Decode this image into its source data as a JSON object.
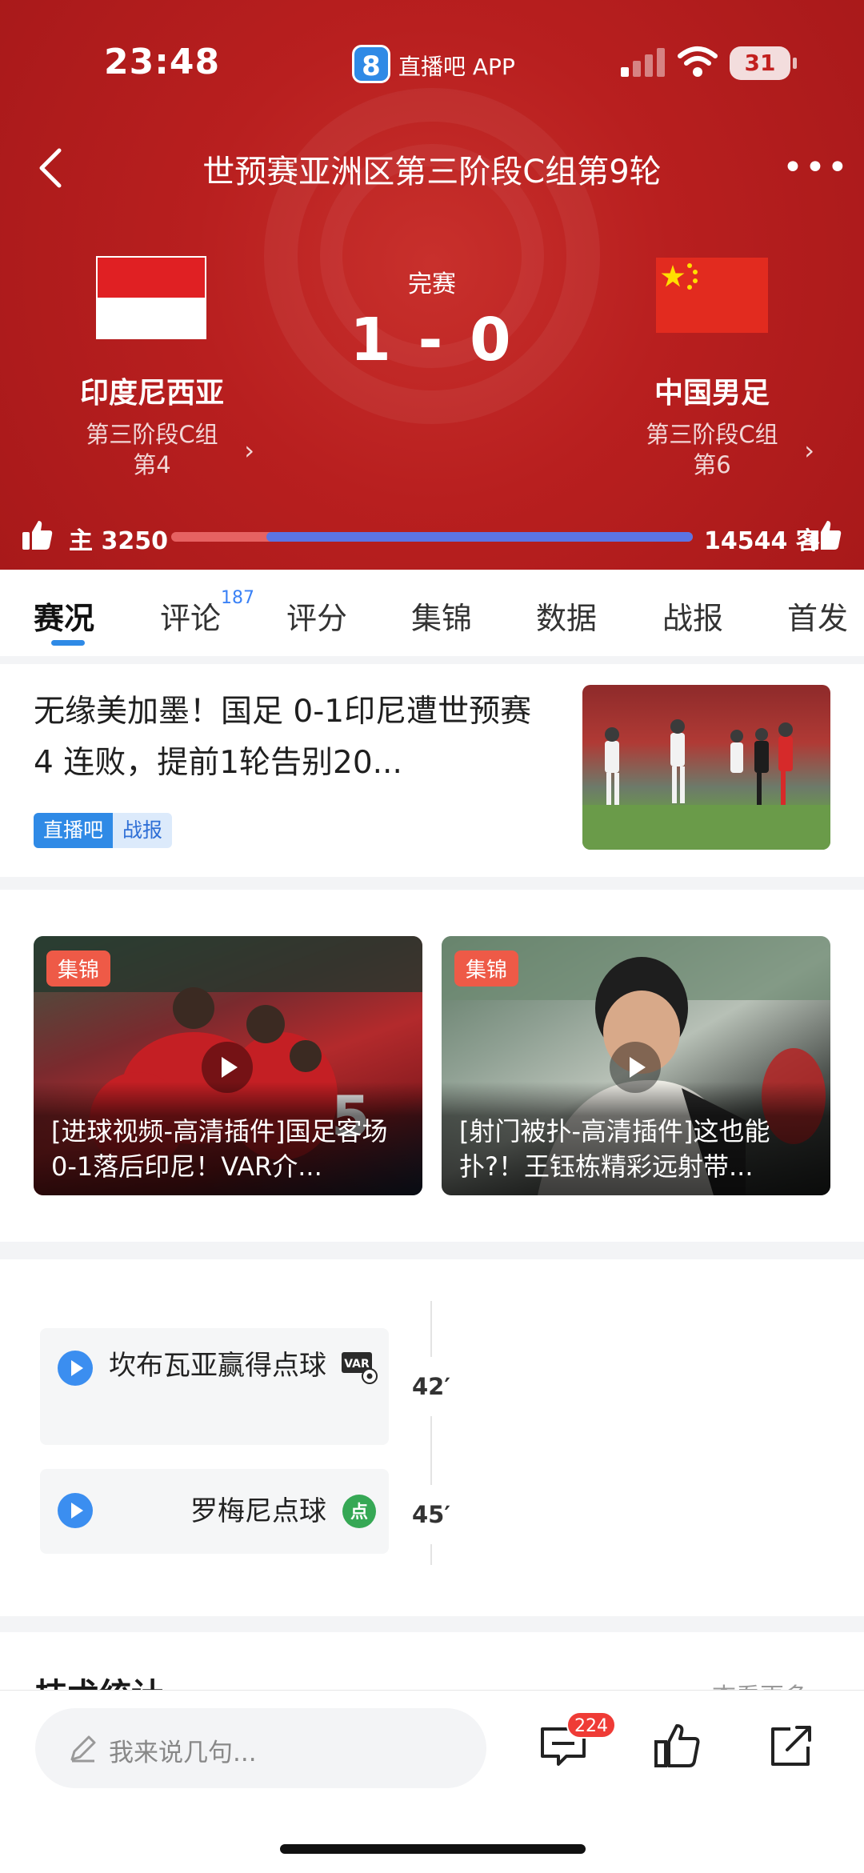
{
  "status_bar": {
    "time": "23:48",
    "app_badge": "8",
    "app_name": "直播吧 APP",
    "battery": "31"
  },
  "nav": {
    "title": "世预赛亚洲区第三阶段C组第9轮",
    "more": "•••"
  },
  "match": {
    "status": "完赛",
    "score": "1 - 0",
    "home": {
      "name": "印度尼西亚",
      "group": "第三阶段C组",
      "rank": "第4"
    },
    "away": {
      "name": "中国男足",
      "group": "第三阶段C组",
      "rank": "第6"
    }
  },
  "vote": {
    "home_label": "主 3250",
    "away_label": "14544 客",
    "home_votes": 3250,
    "away_votes": 14544,
    "colors": {
      "home": "#e66262",
      "away": "#5b74e4"
    }
  },
  "tabs": [
    {
      "label": "赛况",
      "active": true
    },
    {
      "label": "评论",
      "count": "187"
    },
    {
      "label": "评分"
    },
    {
      "label": "集锦"
    },
    {
      "label": "数据"
    },
    {
      "label": "战报"
    },
    {
      "label": "首发"
    }
  ],
  "article": {
    "headline": "无缘美加墨！国足 0-1印尼遭世预赛 4 连败，提前1轮告别20...",
    "tag_source": "直播吧",
    "tag_type": "战报"
  },
  "highlights": [
    {
      "badge": "集锦",
      "caption": "[进球视频-高清插件]国足客场0-1落后印尼！VAR介..."
    },
    {
      "badge": "集锦",
      "caption": "[射门被扑-高清插件]这也能扑?！王钰栋精彩远射带..."
    }
  ],
  "events": [
    {
      "text": "坎布瓦亚赢得点球",
      "icon": "var-icon",
      "minute": "42′"
    },
    {
      "text": "罗梅尼点球",
      "icon": "penalty-icon",
      "minute": "45′"
    }
  ],
  "tech": {
    "title": "技术统计",
    "more": "查看更多 >"
  },
  "bottom": {
    "placeholder": "我来说几句...",
    "comment_count": "224"
  },
  "accent": "#2f8ae6",
  "brand_red": "#b81f1f"
}
